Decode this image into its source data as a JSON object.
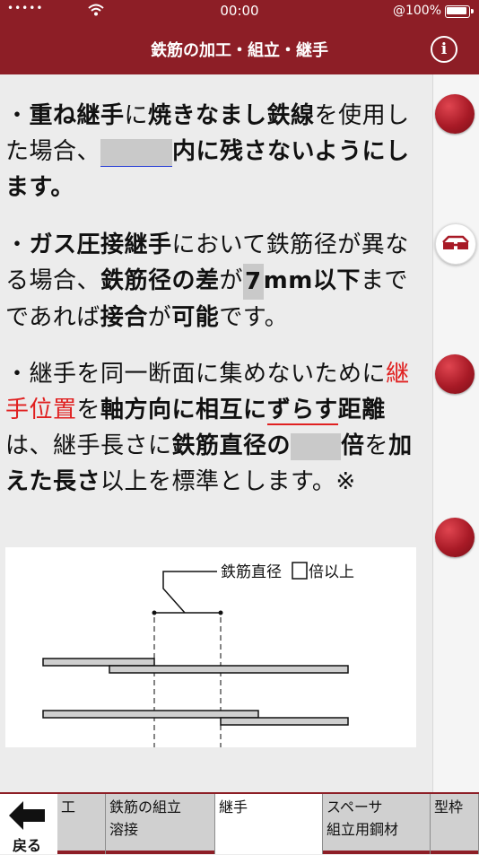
{
  "status": {
    "dots": "•••••",
    "time": "00:00",
    "battery": "100%"
  },
  "header": {
    "title": "鉄筋の加工・組立・継手",
    "info_label": "i"
  },
  "content": {
    "p1": {
      "bullet": "・",
      "t1": "重ね継手",
      "t2": "に",
      "t3": "焼きなまし鉄線",
      "t4": "を使用した場合、",
      "t5": "内に残さないようにします。"
    },
    "p2": {
      "bullet": "・",
      "t1": "ガス圧接継手",
      "t2": "において鉄筋径が異なる場合、",
      "t3": "鉄筋径の差",
      "t4": "が",
      "t5": "7",
      "t6": "mm以下",
      "t7": "までであれば",
      "t8": "接合",
      "t9": "が",
      "t10": "可能",
      "t11": "です。"
    },
    "p3": {
      "bullet": "・",
      "t1": "継手を同一断面に集めないために",
      "t2": "継手位置",
      "t3": "を",
      "t4": "軸方向に相互に",
      "t5": "ずらす",
      "t6": "距離",
      "t7": "は、継手長さに",
      "t8": "鉄筋直径の",
      "t9": "倍",
      "t10": "を",
      "t11": "加えた長さ",
      "t12": "以上を標準とします。※"
    },
    "figure_label_1": "鉄筋直径",
    "figure_label_2": "倍以上"
  },
  "tabs": {
    "back_label": "戻る",
    "items": [
      {
        "line1": "工",
        "line2": ""
      },
      {
        "line1": "鉄筋の組立",
        "line2": "溶接"
      },
      {
        "line1": "継手",
        "line2": ""
      },
      {
        "line1": "スペーサ",
        "line2": "組立用鋼材"
      },
      {
        "line1": "型枠",
        "line2": ""
      }
    ]
  },
  "colors": {
    "brand": "#8d1e26",
    "highlight_red": "#e02020"
  }
}
